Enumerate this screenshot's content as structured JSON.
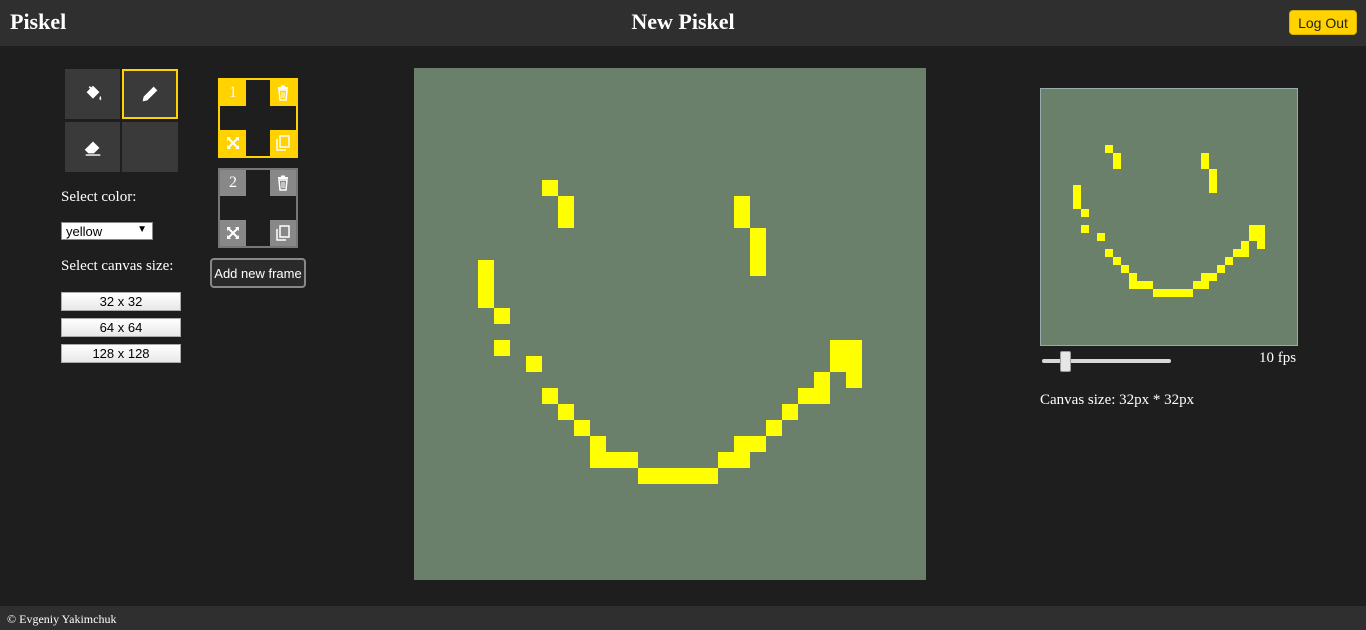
{
  "app": {
    "logo": "Piskel",
    "title": "New Piskel",
    "logout_label": "Log Out"
  },
  "tools": [
    {
      "name": "paint-bucket",
      "active": false
    },
    {
      "name": "pencil",
      "active": true
    },
    {
      "name": "eraser",
      "active": false
    },
    {
      "name": "empty",
      "active": false
    }
  ],
  "color": {
    "label": "Select color:",
    "selected": "yellow",
    "value_hex": "#ffff00"
  },
  "canvas_size_section": {
    "label": "Select canvas size:",
    "options": [
      "32 x 32",
      "64 x 64",
      "128 x 128"
    ]
  },
  "frames": [
    {
      "number": "1",
      "active": true
    },
    {
      "number": "2",
      "active": false
    }
  ],
  "add_frame_label": "Add new frame",
  "preview": {
    "fps_label": "10 fps",
    "fps_value": 10,
    "canvas_size_text": "Canvas size: 32px * 32px"
  },
  "footer": {
    "text": "© Evgeniy Yakimchuk"
  },
  "colors": {
    "accent": "#ffd200",
    "canvas_bg": "#6a806a",
    "pixel": "#ffff00",
    "panel": "#2f2f2f",
    "background": "#1e1e1e"
  },
  "drawing": {
    "grid": 32,
    "pixels": [
      [
        8,
        7
      ],
      [
        9,
        8
      ],
      [
        9,
        9
      ],
      [
        20,
        8
      ],
      [
        20,
        9
      ],
      [
        21,
        10
      ],
      [
        21,
        11
      ],
      [
        21,
        12
      ],
      [
        4,
        12
      ],
      [
        4,
        13
      ],
      [
        4,
        14
      ],
      [
        5,
        15
      ],
      [
        5,
        17
      ],
      [
        7,
        18
      ],
      [
        8,
        20
      ],
      [
        9,
        21
      ],
      [
        10,
        22
      ],
      [
        11,
        23
      ],
      [
        11,
        24
      ],
      [
        12,
        24
      ],
      [
        13,
        24
      ],
      [
        14,
        25
      ],
      [
        15,
        25
      ],
      [
        16,
        25
      ],
      [
        17,
        25
      ],
      [
        18,
        25
      ],
      [
        19,
        24
      ],
      [
        20,
        24
      ],
      [
        20,
        23
      ],
      [
        21,
        23
      ],
      [
        22,
        22
      ],
      [
        23,
        21
      ],
      [
        24,
        20
      ],
      [
        25,
        20
      ],
      [
        25,
        19
      ],
      [
        26,
        18
      ],
      [
        26,
        17
      ],
      [
        27,
        17
      ],
      [
        27,
        18
      ],
      [
        27,
        19
      ]
    ]
  }
}
